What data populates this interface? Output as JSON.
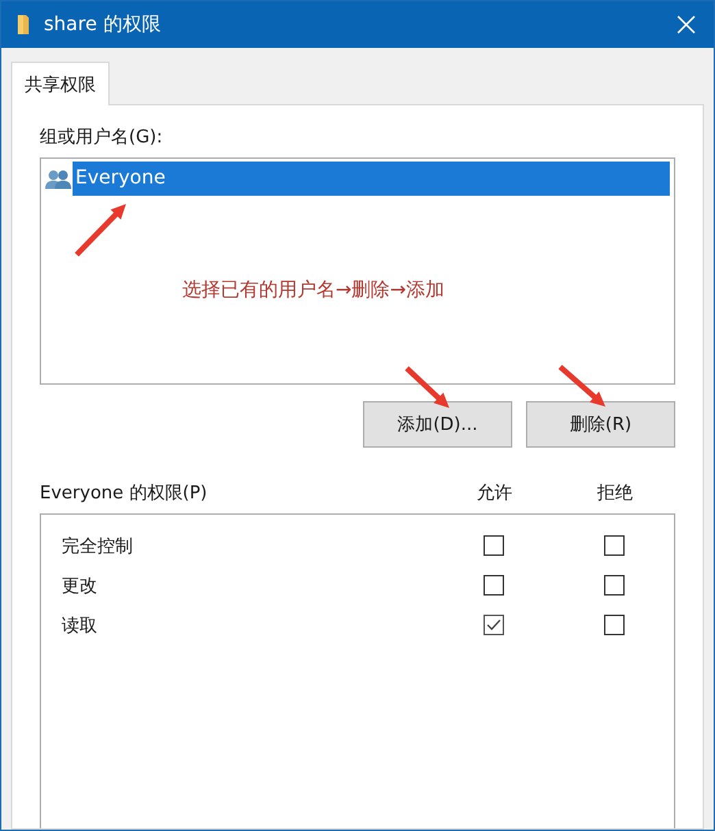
{
  "window": {
    "title": "share 的权限"
  },
  "tabs": [
    {
      "label": "共享权限",
      "selected": true
    }
  ],
  "group_list": {
    "label": "组或用户名(G):",
    "items": [
      {
        "name": "Everyone",
        "selected": true
      }
    ]
  },
  "annotation": "选择已有的用户名→删除→添加",
  "buttons": [
    "添加(D)...",
    "删除(R)"
  ],
  "permissions": {
    "label": "Everyone 的权限(P)",
    "columns": [
      "允许",
      "拒绝"
    ],
    "rows": [
      {
        "name": "完全控制",
        "allow": false,
        "deny": false
      },
      {
        "name": "更改",
        "allow": false,
        "deny": false
      },
      {
        "name": "读取",
        "allow": true,
        "deny": false
      }
    ]
  }
}
